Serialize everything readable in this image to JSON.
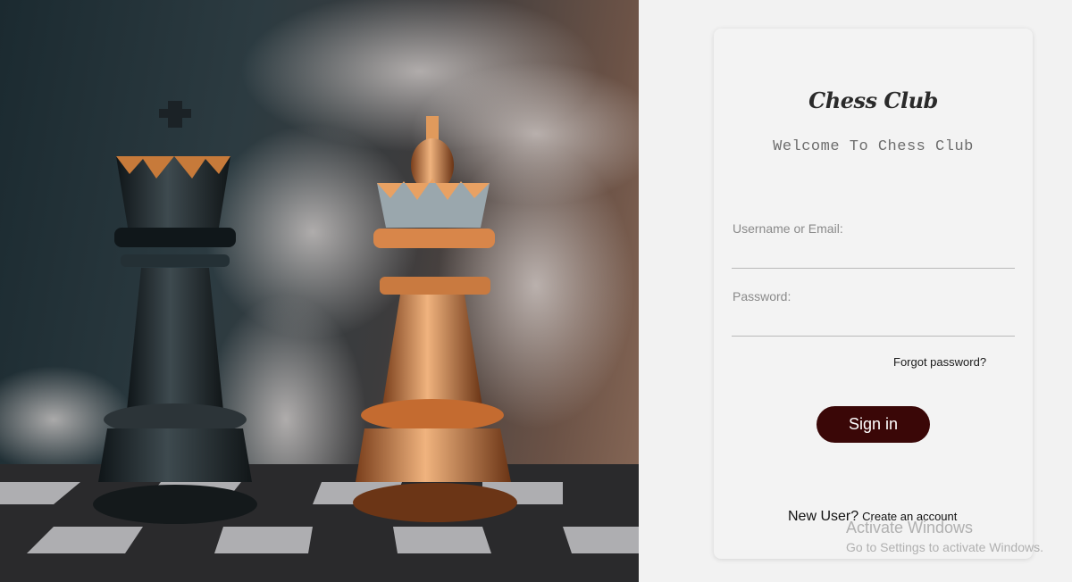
{
  "brand": {
    "title": "Chess Club",
    "subtitle": "Welcome To Chess Club"
  },
  "form": {
    "username_label": "Username or Email:",
    "username_value": "",
    "password_label": "Password:",
    "password_value": "",
    "forgot_link": "Forgot password?",
    "signin_button": "Sign in"
  },
  "footer": {
    "new_user_text": "New User?",
    "create_link": "Create an account"
  },
  "watermark": {
    "title": "Activate Windows",
    "subtitle": "Go to Settings to activate Windows."
  },
  "hero": {
    "image": "chess-kings-smoke"
  },
  "colors": {
    "accent": "#3a0707",
    "page_bg": "#f2f2f2",
    "card_bg": "#f3f3f3"
  }
}
